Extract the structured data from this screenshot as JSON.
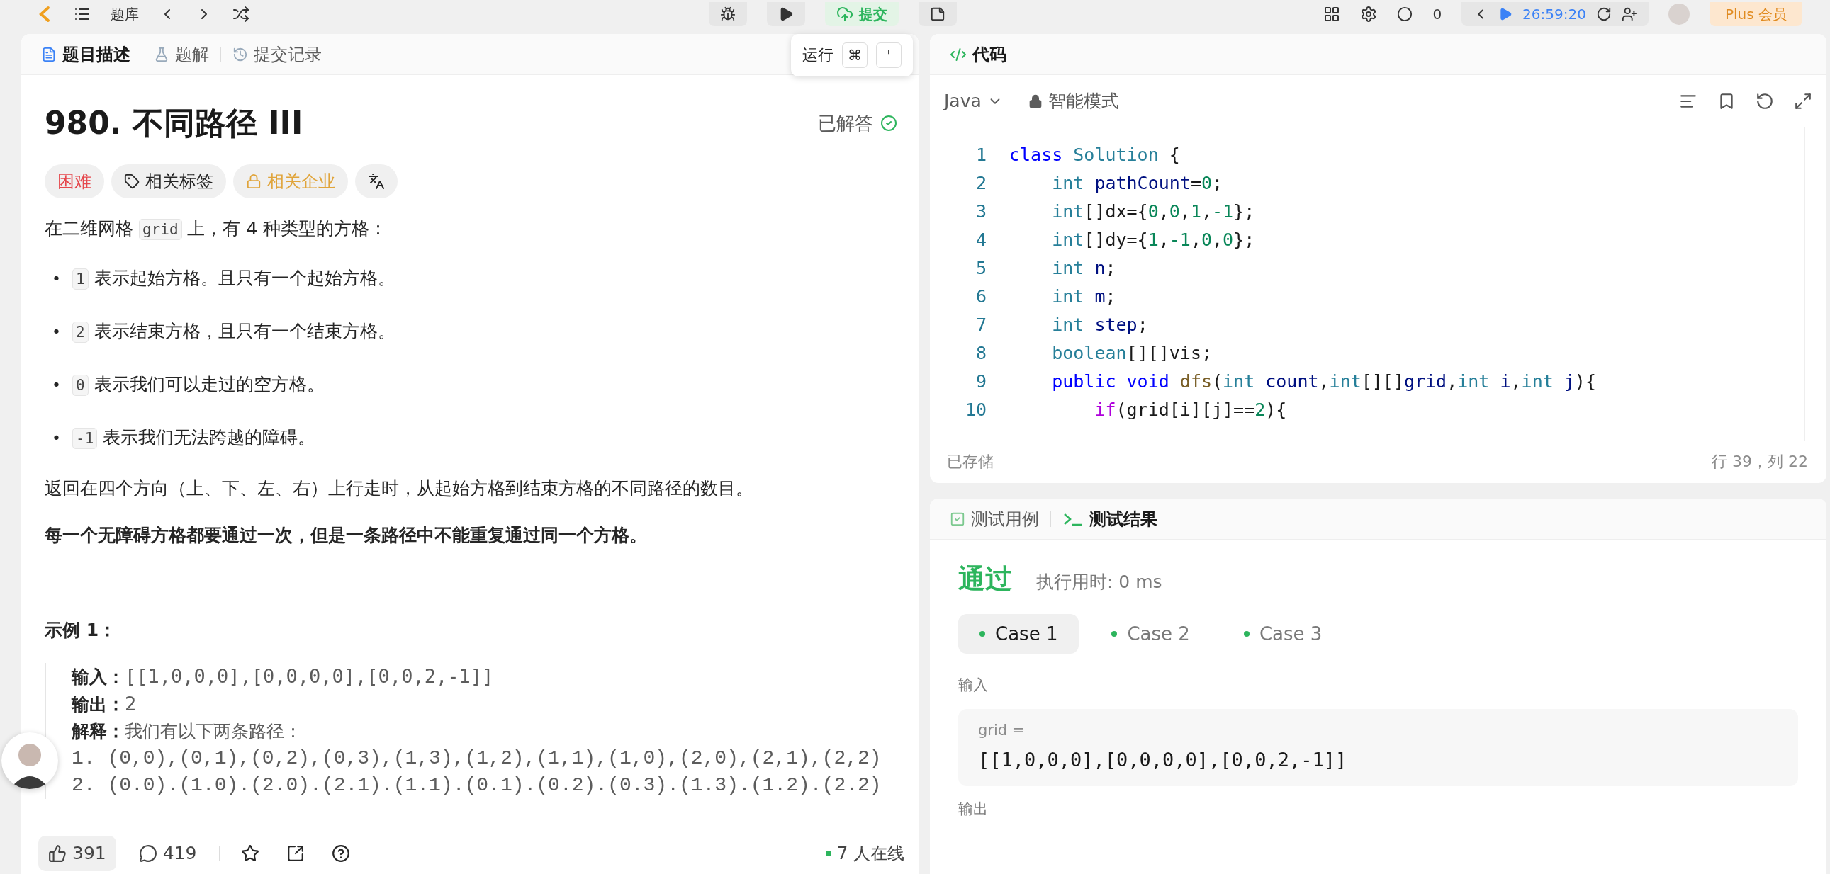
{
  "top_bar": {
    "problem_bank": "题库",
    "submit": "提交",
    "points": "0",
    "timer": "26:59:20",
    "plus": "Plus 会员"
  },
  "tooltip": {
    "label": "运行",
    "keys": [
      "⌘",
      "'"
    ]
  },
  "description_panel": {
    "tabs": [
      {
        "label": "题目描述",
        "selected": true
      },
      {
        "label": "题解",
        "selected": false
      },
      {
        "label": "提交记录",
        "selected": false
      }
    ],
    "title": "980. 不同路径 III",
    "status": "已解答",
    "tags": [
      {
        "kind": "difficulty",
        "label": "困难"
      },
      {
        "kind": "topics",
        "label": "相关标签"
      },
      {
        "kind": "locked",
        "label": "相关企业"
      }
    ],
    "intro": [
      {
        "kind": "text",
        "text": "在二维网格 "
      },
      {
        "kind": "code",
        "text": "grid"
      },
      {
        "kind": "text",
        "text": " 上，有 4 种类型的方格："
      }
    ],
    "bullets": [
      {
        "marker": "•",
        "code": "1",
        "text": "表示起始方格。且只有一个起始方格。"
      },
      {
        "marker": "•",
        "code": "2",
        "text": "表示结束方格，且只有一个结束方格。"
      },
      {
        "marker": "•",
        "code": "0",
        "text": "表示我们可以走过的空方格。"
      },
      {
        "marker": "•",
        "code": "-1",
        "text": "表示我们无法跨越的障碍。"
      }
    ],
    "paragraph": "返回在四个方向（上、下、左、右）上行走时，从起始方格到结束方格的不同路径的数目。",
    "bold_paragraph": "每一个无障碍方格都要通过一次，但是一条路径中不能重复通过同一个方格。",
    "example": {
      "title": "示例 1：",
      "lines": [
        {
          "label": "输入：",
          "value": "[[1,0,0,0],[0,0,0,0],[0,0,2,-1]]"
        },
        {
          "label": "输出：",
          "value": "2"
        },
        {
          "label": "解释：",
          "value": "我们有以下两条路径："
        }
      ],
      "paths": [
        "1. (0,0),(0,1),(0,2),(0,3),(1,3),(1,2),(1,1),(1,0),(2,0),(2,1),(2,2)",
        "2. (0.0).(1.0).(2.0).(2.1).(1.1).(0.1).(0.2).(0.3).(1.3).(1.2).(2.2)"
      ]
    },
    "footer": {
      "likes": "391",
      "comments": "419",
      "online": "7 人在线"
    }
  },
  "code_panel": {
    "tab": "代码",
    "language": "Java",
    "mode": "智能模式",
    "lines": [
      {
        "number": "1",
        "tokens": [
          {
            "kind": "keyword",
            "text": "class"
          },
          {
            "kind": "type",
            "text": " Solution"
          },
          {
            "kind": "plain",
            "text": " {"
          }
        ]
      },
      {
        "number": "2",
        "tokens": [
          {
            "kind": "type",
            "text": "    int"
          },
          {
            "kind": "variable",
            "text": " pathCount"
          },
          {
            "kind": "plain",
            "text": "="
          },
          {
            "kind": "number",
            "text": "0"
          },
          {
            "kind": "plain",
            "text": ";"
          }
        ]
      },
      {
        "number": "3",
        "tokens": [
          {
            "kind": "type",
            "text": "    int"
          },
          {
            "kind": "plain",
            "text": "[]dx={"
          },
          {
            "kind": "number",
            "text": "0"
          },
          {
            "kind": "plain",
            "text": ","
          },
          {
            "kind": "number",
            "text": "0"
          },
          {
            "kind": "plain",
            "text": ","
          },
          {
            "kind": "number",
            "text": "1"
          },
          {
            "kind": "plain",
            "text": ","
          },
          {
            "kind": "number",
            "text": "-1"
          },
          {
            "kind": "plain",
            "text": "};"
          }
        ]
      },
      {
        "number": "4",
        "tokens": [
          {
            "kind": "type",
            "text": "    int"
          },
          {
            "kind": "plain",
            "text": "[]dy={"
          },
          {
            "kind": "number",
            "text": "1"
          },
          {
            "kind": "plain",
            "text": ","
          },
          {
            "kind": "number",
            "text": "-1"
          },
          {
            "kind": "plain",
            "text": ","
          },
          {
            "kind": "number",
            "text": "0"
          },
          {
            "kind": "plain",
            "text": ","
          },
          {
            "kind": "number",
            "text": "0"
          },
          {
            "kind": "plain",
            "text": "};"
          }
        ]
      },
      {
        "number": "5",
        "tokens": [
          {
            "kind": "type",
            "text": "    int"
          },
          {
            "kind": "variable",
            "text": " n"
          },
          {
            "kind": "plain",
            "text": ";"
          }
        ]
      },
      {
        "number": "6",
        "tokens": [
          {
            "kind": "type",
            "text": "    int"
          },
          {
            "kind": "variable",
            "text": " m"
          },
          {
            "kind": "plain",
            "text": ";"
          }
        ]
      },
      {
        "number": "7",
        "tokens": [
          {
            "kind": "type",
            "text": "    int"
          },
          {
            "kind": "variable",
            "text": " step"
          },
          {
            "kind": "plain",
            "text": ";"
          }
        ]
      },
      {
        "number": "8",
        "tokens": [
          {
            "kind": "type",
            "text": "    boolean"
          },
          {
            "kind": "plain",
            "text": "[][]vis;"
          }
        ]
      },
      {
        "number": "9",
        "tokens": [
          {
            "kind": "keyword",
            "text": "    public"
          },
          {
            "kind": "keyword",
            "text": " void"
          },
          {
            "kind": "function",
            "text": " dfs"
          },
          {
            "kind": "plain",
            "text": "("
          },
          {
            "kind": "type",
            "text": "int"
          },
          {
            "kind": "variable",
            "text": " count"
          },
          {
            "kind": "plain",
            "text": ","
          },
          {
            "kind": "type",
            "text": "int"
          },
          {
            "kind": "plain",
            "text": "[][]"
          },
          {
            "kind": "variable",
            "text": "grid"
          },
          {
            "kind": "plain",
            "text": ","
          },
          {
            "kind": "type",
            "text": "int"
          },
          {
            "kind": "variable",
            "text": " i"
          },
          {
            "kind": "plain",
            "text": ","
          },
          {
            "kind": "type",
            "text": "int"
          },
          {
            "kind": "variable",
            "text": " j"
          },
          {
            "kind": "plain",
            "text": "){"
          }
        ]
      },
      {
        "number": "10",
        "tokens": [
          {
            "kind": "control",
            "text": "        if"
          },
          {
            "kind": "plain",
            "text": "(grid[i][j]=="
          },
          {
            "kind": "number",
            "text": "2"
          },
          {
            "kind": "plain",
            "text": "){"
          }
        ]
      }
    ],
    "saved": "已存储",
    "cursor": "行 39，列 22"
  },
  "test_panel": {
    "tabs": [
      {
        "label": "测试用例",
        "selected": false
      },
      {
        "label": "测试结果",
        "selected": true
      }
    ],
    "verdict": "通过",
    "runtime": "执行用时: 0 ms",
    "cases": [
      {
        "label": "Case 1",
        "selected": true,
        "color": "#2db55d"
      },
      {
        "label": "Case 2",
        "selected": false,
        "color": "#2db55d"
      },
      {
        "label": "Case 3",
        "selected": false,
        "color": "#2db55d"
      }
    ],
    "input_label": "输入",
    "param": "grid =",
    "value": "[[1,0,0,0],[0,0,0,0],[0,0,2,-1]]",
    "output_label": "输出"
  }
}
